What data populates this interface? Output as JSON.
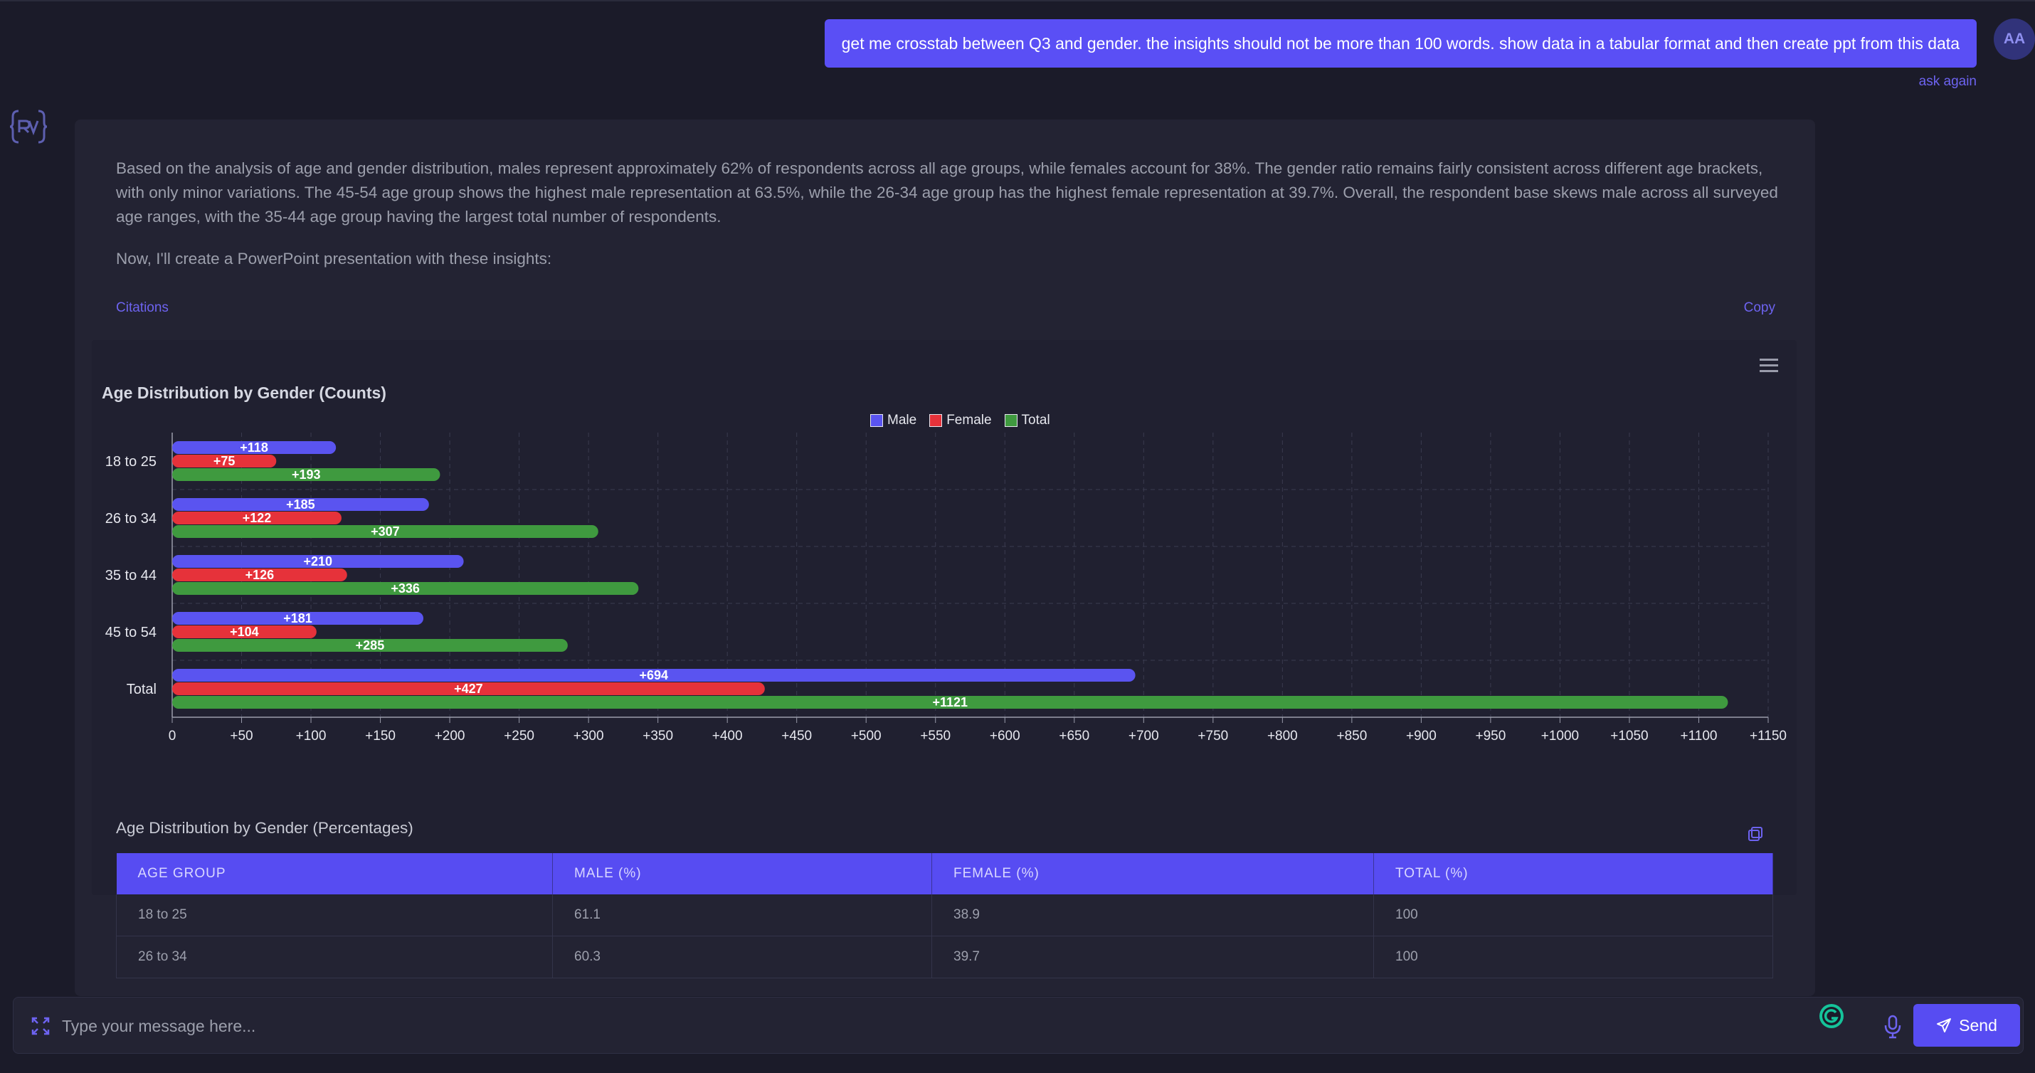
{
  "user_message": {
    "text": "get me crosstab between Q3 and gender. the insights should not be more than 100 words. show data in a tabular format and then create ppt from this data",
    "ask_again_label": "ask again",
    "avatar_initials": "AA"
  },
  "response": {
    "insight": "Based on the analysis of age and gender distribution, males represent approximately 62% of respondents across all age groups, while females account for 38%. The gender ratio remains fairly consistent across different age brackets, with only minor variations. The 45-54 age group shows the highest male representation at 63.5%, while the 26-34 age group has the highest female representation at 39.7%. Overall, the respondent base skews male across all surveyed age ranges, with the 35-44 age group having the largest total number of respondents.",
    "followup": "Now, I'll create a PowerPoint presentation with these insights:",
    "citations_label": "Citations",
    "copy_label": "Copy"
  },
  "chart_data": {
    "type": "bar",
    "orientation": "horizontal",
    "title": "Age Distribution by Gender (Counts)",
    "categories": [
      "18 to 25",
      "26 to 34",
      "35 to 44",
      "45 to 54",
      "Total"
    ],
    "series": [
      {
        "name": "Male",
        "color": "#5a54f0",
        "values": [
          118,
          185,
          210,
          181,
          694
        ]
      },
      {
        "name": "Female",
        "color": "#e6323a",
        "values": [
          75,
          122,
          126,
          104,
          427
        ]
      },
      {
        "name": "Total",
        "color": "#3f9a3f",
        "values": [
          193,
          307,
          336,
          285,
          1121
        ]
      }
    ],
    "data_label_prefix": "+",
    "xlim": [
      0,
      1150
    ],
    "x_ticks": [
      "0",
      "+50",
      "+100",
      "+150",
      "+200",
      "+250",
      "+300",
      "+350",
      "+400",
      "+450",
      "+500",
      "+550",
      "+600",
      "+650",
      "+700",
      "+750",
      "+800",
      "+850",
      "+900",
      "+950",
      "+1000",
      "+1050",
      "+1100",
      "+1150"
    ],
    "grid": true,
    "legend_position": "top-center"
  },
  "table": {
    "title": "Age Distribution by Gender (Percentages)",
    "headers": [
      "AGE GROUP",
      "MALE (%)",
      "FEMALE (%)",
      "TOTAL (%)"
    ],
    "rows": [
      [
        "18 to 25",
        "61.1",
        "38.9",
        "100"
      ],
      [
        "26 to 34",
        "60.3",
        "39.7",
        "100"
      ]
    ]
  },
  "composer": {
    "placeholder": "Type your message here...",
    "send_label": "Send"
  },
  "colors": {
    "accent": "#574cf2",
    "background": "#1b1b29",
    "panel": "#232333"
  }
}
